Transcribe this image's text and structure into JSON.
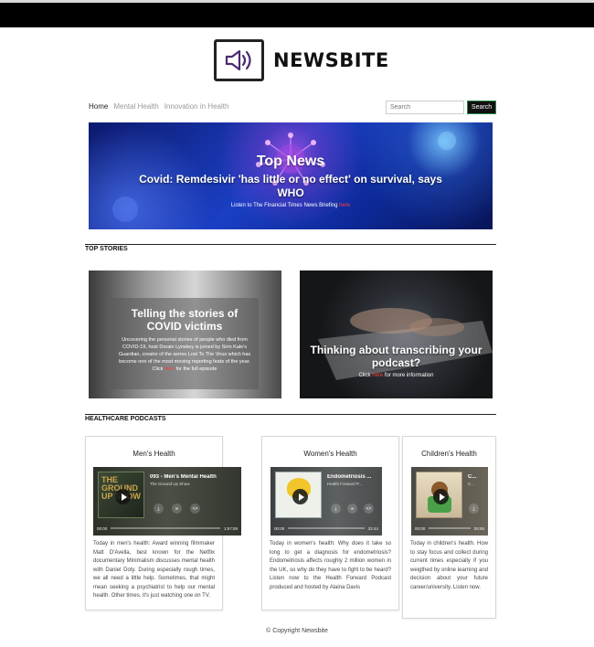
{
  "brand": {
    "name": "NEWSBITE",
    "logo_icon": "speaker-icon"
  },
  "nav": {
    "items": [
      "Home",
      "Mental Health",
      "Innovation in Health"
    ]
  },
  "search": {
    "placeholder": "Search",
    "button": "Search"
  },
  "hero": {
    "title": "Top News",
    "headline": "Covid: Remdesivir 'has little or no effect' on survival, says WHO",
    "sub_prefix": "Listen to The Financial Times News Briefing",
    "sub_link": "here"
  },
  "sections": {
    "top_stories": "TOP STORIES",
    "podcasts": "HEALTHCARE PODCASTS"
  },
  "stories": [
    {
      "title": "Telling the stories of COVID victims",
      "body_prefix": "Uncovering the personal stories of people who died from COVID-19, host Dorain Lynskey is joined by Sirin Kale's Guardian, creator of the series Lost To The Virus which has become one of the most moving reporting feats of the year. Click",
      "body_link": "here",
      "body_suffix": "for the full episode"
    },
    {
      "title": "Thinking about transcribing your podcast?",
      "sub_prefix": "Click",
      "sub_link": "here",
      "sub_suffix": "for more information"
    }
  ],
  "podcasts": [
    {
      "heading": "Men's Health",
      "episode": "093 - Men's Mental Health",
      "show": "The Ground Up Show",
      "thumb_text": "THE GROUND UP SHOW",
      "time_start": "00:00",
      "time_end": "1:57:59",
      "body": "Today in men's health: Award winning filmmaker Matt D'Avella, best known for the Netflix documentary Minimalism discusses mental health with Daniel Doty. During especially rough times, we all need a little help. Sometimes, that might mean seeking a psychiatrist to help our mental health. Other times, it's just watching one on TV."
    },
    {
      "heading": "Women's Health",
      "episode": "Endometriosis ...",
      "show": "Health Forward P...",
      "time_start": "00:00",
      "time_end": "32:44",
      "body": "Today in women's health: Why does it take so long to get a diagnosis for endometriosis? Endometriosis affects roughly 2 million women in the UK, so why do they have to fight to be heard? Listen now to the Health Forward Podcast produced and hosted by Alaina Davis"
    },
    {
      "heading": "Children's Health",
      "episode": "C...",
      "show": "C...",
      "time_start": "00:00",
      "time_end": "05:55",
      "body": "Today in children's health. How to stay focus and collect during current times especially if you weigthed by online learning and decision about your future career/university. Listen now."
    }
  ],
  "footer": {
    "copyright": "© Copyright Newsbite"
  },
  "colors": {
    "link_red": "#ff4040",
    "hero_blue": "#1b3fc4",
    "search_border": "#2a8a4a"
  }
}
